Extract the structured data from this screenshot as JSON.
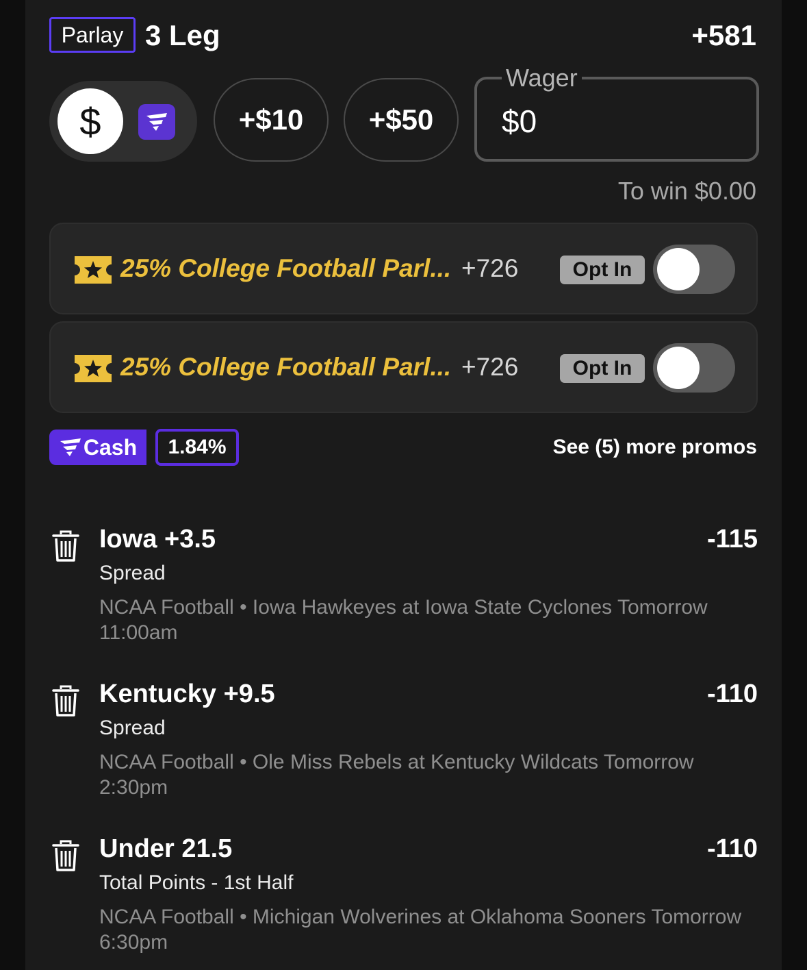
{
  "header": {
    "bet_type": "Parlay",
    "leg_count": "3 Leg",
    "total_odds": "+581"
  },
  "wager": {
    "currency_symbol": "$",
    "quick_add": [
      "+$10",
      "+$50"
    ],
    "label": "Wager",
    "value": "$0",
    "to_win": "To win $0.00"
  },
  "promos": [
    {
      "title": "25% College Football Parl...",
      "odds": "+726",
      "opt_in_label": "Opt In",
      "enabled": false,
      "icon": "ticket-star-icon"
    },
    {
      "title": "25% College Football Parl...",
      "odds": "+726",
      "opt_in_label": "Opt In",
      "enabled": false,
      "icon": "ticket-star-icon"
    }
  ],
  "fcash": {
    "label": "Cash",
    "percent": "1.84%",
    "more_promos": "See (5) more promos"
  },
  "legs": [
    {
      "selection": "Iowa +3.5",
      "odds": "-115",
      "market": "Spread",
      "event": "NCAA Football • Iowa Hawkeyes at Iowa State Cyclones Tomorrow 11:00am"
    },
    {
      "selection": "Kentucky +9.5",
      "odds": "-110",
      "market": "Spread",
      "event": "NCAA Football • Ole Miss Rebels at Kentucky Wildcats Tomorrow 2:30pm"
    },
    {
      "selection": "Under 21.5",
      "odds": "-110",
      "market": "Total Points - 1st Half",
      "event": "NCAA Football • Michigan Wolverines at Oklahoma Sooners Tomorrow 6:30pm"
    }
  ],
  "colors": {
    "accent": "#5b2de0",
    "promo_gold": "#ecc03d",
    "background": "#1b1b1b"
  }
}
